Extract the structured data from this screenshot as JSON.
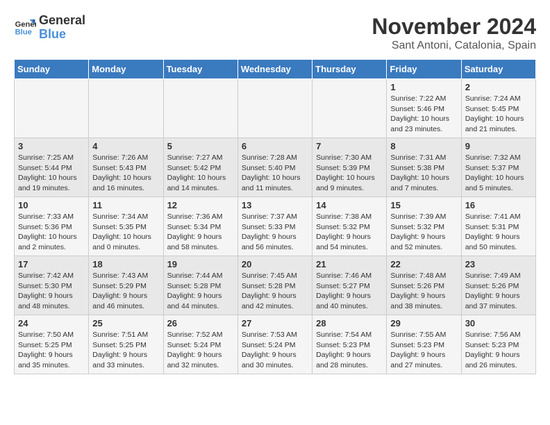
{
  "logo": {
    "line1": "General",
    "line2": "Blue"
  },
  "title": "November 2024",
  "location": "Sant Antoni, Catalonia, Spain",
  "days_of_week": [
    "Sunday",
    "Monday",
    "Tuesday",
    "Wednesday",
    "Thursday",
    "Friday",
    "Saturday"
  ],
  "weeks": [
    [
      {
        "day": "",
        "detail": ""
      },
      {
        "day": "",
        "detail": ""
      },
      {
        "day": "",
        "detail": ""
      },
      {
        "day": "",
        "detail": ""
      },
      {
        "day": "",
        "detail": ""
      },
      {
        "day": "1",
        "detail": "Sunrise: 7:22 AM\nSunset: 5:46 PM\nDaylight: 10 hours and 23 minutes."
      },
      {
        "day": "2",
        "detail": "Sunrise: 7:24 AM\nSunset: 5:45 PM\nDaylight: 10 hours and 21 minutes."
      }
    ],
    [
      {
        "day": "3",
        "detail": "Sunrise: 7:25 AM\nSunset: 5:44 PM\nDaylight: 10 hours and 19 minutes."
      },
      {
        "day": "4",
        "detail": "Sunrise: 7:26 AM\nSunset: 5:43 PM\nDaylight: 10 hours and 16 minutes."
      },
      {
        "day": "5",
        "detail": "Sunrise: 7:27 AM\nSunset: 5:42 PM\nDaylight: 10 hours and 14 minutes."
      },
      {
        "day": "6",
        "detail": "Sunrise: 7:28 AM\nSunset: 5:40 PM\nDaylight: 10 hours and 11 minutes."
      },
      {
        "day": "7",
        "detail": "Sunrise: 7:30 AM\nSunset: 5:39 PM\nDaylight: 10 hours and 9 minutes."
      },
      {
        "day": "8",
        "detail": "Sunrise: 7:31 AM\nSunset: 5:38 PM\nDaylight: 10 hours and 7 minutes."
      },
      {
        "day": "9",
        "detail": "Sunrise: 7:32 AM\nSunset: 5:37 PM\nDaylight: 10 hours and 5 minutes."
      }
    ],
    [
      {
        "day": "10",
        "detail": "Sunrise: 7:33 AM\nSunset: 5:36 PM\nDaylight: 10 hours and 2 minutes."
      },
      {
        "day": "11",
        "detail": "Sunrise: 7:34 AM\nSunset: 5:35 PM\nDaylight: 10 hours and 0 minutes."
      },
      {
        "day": "12",
        "detail": "Sunrise: 7:36 AM\nSunset: 5:34 PM\nDaylight: 9 hours and 58 minutes."
      },
      {
        "day": "13",
        "detail": "Sunrise: 7:37 AM\nSunset: 5:33 PM\nDaylight: 9 hours and 56 minutes."
      },
      {
        "day": "14",
        "detail": "Sunrise: 7:38 AM\nSunset: 5:32 PM\nDaylight: 9 hours and 54 minutes."
      },
      {
        "day": "15",
        "detail": "Sunrise: 7:39 AM\nSunset: 5:32 PM\nDaylight: 9 hours and 52 minutes."
      },
      {
        "day": "16",
        "detail": "Sunrise: 7:41 AM\nSunset: 5:31 PM\nDaylight: 9 hours and 50 minutes."
      }
    ],
    [
      {
        "day": "17",
        "detail": "Sunrise: 7:42 AM\nSunset: 5:30 PM\nDaylight: 9 hours and 48 minutes."
      },
      {
        "day": "18",
        "detail": "Sunrise: 7:43 AM\nSunset: 5:29 PM\nDaylight: 9 hours and 46 minutes."
      },
      {
        "day": "19",
        "detail": "Sunrise: 7:44 AM\nSunset: 5:28 PM\nDaylight: 9 hours and 44 minutes."
      },
      {
        "day": "20",
        "detail": "Sunrise: 7:45 AM\nSunset: 5:28 PM\nDaylight: 9 hours and 42 minutes."
      },
      {
        "day": "21",
        "detail": "Sunrise: 7:46 AM\nSunset: 5:27 PM\nDaylight: 9 hours and 40 minutes."
      },
      {
        "day": "22",
        "detail": "Sunrise: 7:48 AM\nSunset: 5:26 PM\nDaylight: 9 hours and 38 minutes."
      },
      {
        "day": "23",
        "detail": "Sunrise: 7:49 AM\nSunset: 5:26 PM\nDaylight: 9 hours and 37 minutes."
      }
    ],
    [
      {
        "day": "24",
        "detail": "Sunrise: 7:50 AM\nSunset: 5:25 PM\nDaylight: 9 hours and 35 minutes."
      },
      {
        "day": "25",
        "detail": "Sunrise: 7:51 AM\nSunset: 5:25 PM\nDaylight: 9 hours and 33 minutes."
      },
      {
        "day": "26",
        "detail": "Sunrise: 7:52 AM\nSunset: 5:24 PM\nDaylight: 9 hours and 32 minutes."
      },
      {
        "day": "27",
        "detail": "Sunrise: 7:53 AM\nSunset: 5:24 PM\nDaylight: 9 hours and 30 minutes."
      },
      {
        "day": "28",
        "detail": "Sunrise: 7:54 AM\nSunset: 5:23 PM\nDaylight: 9 hours and 28 minutes."
      },
      {
        "day": "29",
        "detail": "Sunrise: 7:55 AM\nSunset: 5:23 PM\nDaylight: 9 hours and 27 minutes."
      },
      {
        "day": "30",
        "detail": "Sunrise: 7:56 AM\nSunset: 5:23 PM\nDaylight: 9 hours and 26 minutes."
      }
    ]
  ]
}
